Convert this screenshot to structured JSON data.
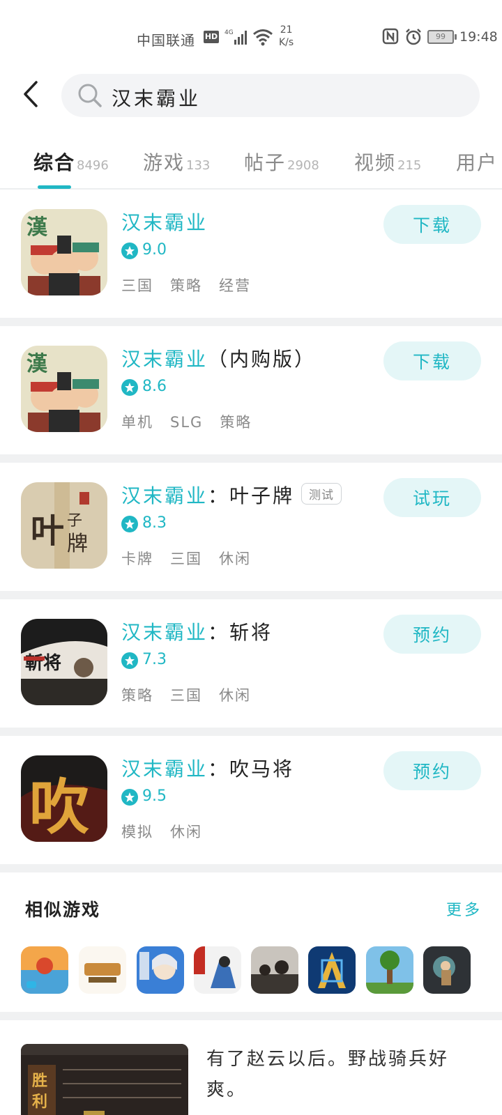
{
  "status_bar": {
    "carrier": "中国联通",
    "network_badge": "HD",
    "network_type": "4G",
    "speed_value": "21",
    "speed_unit": "K/s",
    "battery": "99",
    "time": "19:48"
  },
  "search": {
    "query": "汉末霸业"
  },
  "tabs": [
    {
      "label": "综合",
      "count": "8496",
      "active": true
    },
    {
      "label": "游戏",
      "count": "133",
      "active": false
    },
    {
      "label": "帖子",
      "count": "2908",
      "active": false
    },
    {
      "label": "视频",
      "count": "215",
      "active": false
    },
    {
      "label": "用户",
      "count": "",
      "active": false
    }
  ],
  "results": [
    {
      "title_highlight": "汉末霸业",
      "title_rest": "",
      "badge": "",
      "rating": "9.0",
      "tags": [
        "三国",
        "策略",
        "经营"
      ],
      "action": "下载"
    },
    {
      "title_highlight": "汉末霸业",
      "title_rest": "（内购版）",
      "badge": "",
      "rating": "8.6",
      "tags": [
        "单机",
        "SLG",
        "策略"
      ],
      "action": "下载"
    },
    {
      "title_highlight": "汉末霸业",
      "title_rest": "：叶子牌",
      "badge": "测试",
      "rating": "8.3",
      "tags": [
        "卡牌",
        "三国",
        "休闲"
      ],
      "action": "试玩"
    },
    {
      "title_highlight": "汉末霸业",
      "title_rest": "：斩将",
      "badge": "",
      "rating": "7.3",
      "tags": [
        "策略",
        "三国",
        "休闲"
      ],
      "action": "预约"
    },
    {
      "title_highlight": "汉末霸业",
      "title_rest": "：吹马将",
      "badge": "",
      "rating": "9.5",
      "tags": [
        "模拟",
        "休闲"
      ],
      "action": "预约"
    }
  ],
  "similar": {
    "title": "相似游戏",
    "more": "更多"
  },
  "post": {
    "text": "有了赵云以后。野战骑兵好爽。"
  },
  "colors": {
    "accent": "#20b7c4",
    "button_bg": "#e4f6f7",
    "divider": "#f0f1f2"
  }
}
